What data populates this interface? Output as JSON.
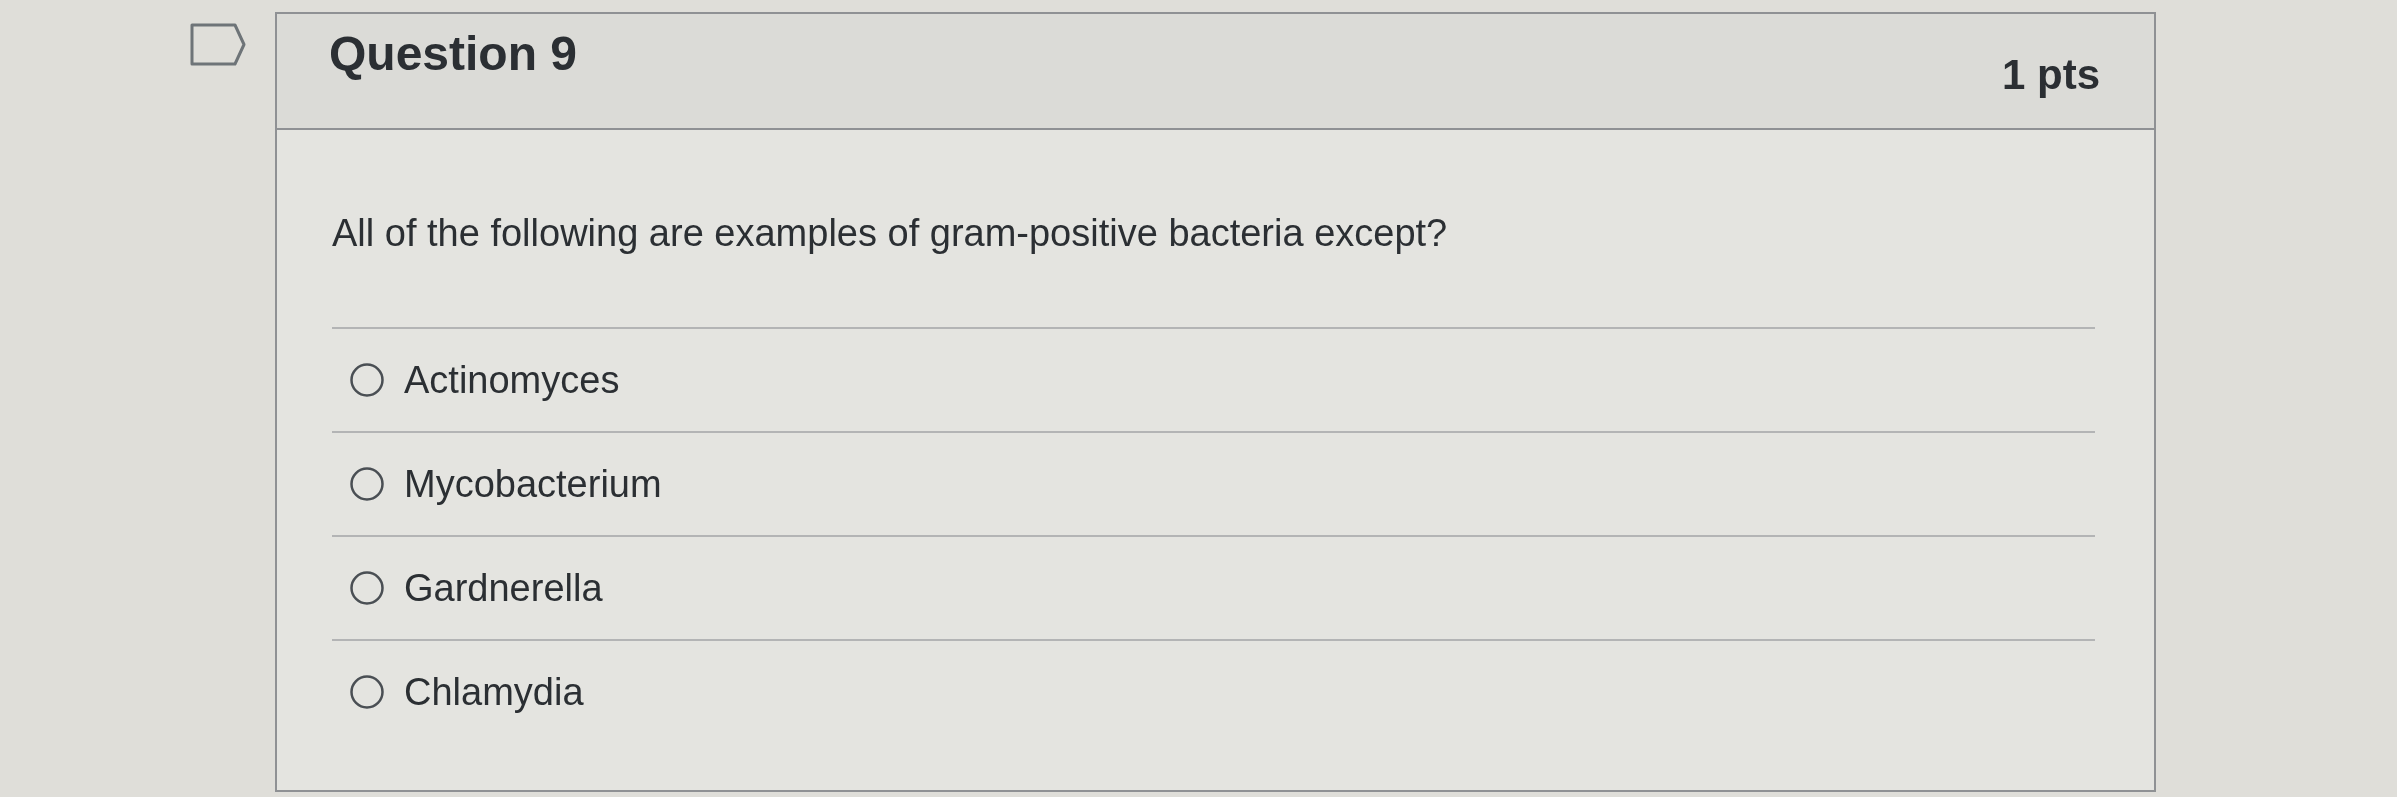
{
  "question": {
    "flagged": false,
    "title": "Question 9",
    "points": "1 pts",
    "text": "All of the following are examples of gram-positive bacteria except?"
  },
  "answers": [
    {
      "label": "Actinomyces",
      "selected": false
    },
    {
      "label": "Mycobacterium",
      "selected": false
    },
    {
      "label": "Gardnerella",
      "selected": false
    },
    {
      "label": "Chlamydia",
      "selected": false
    }
  ]
}
